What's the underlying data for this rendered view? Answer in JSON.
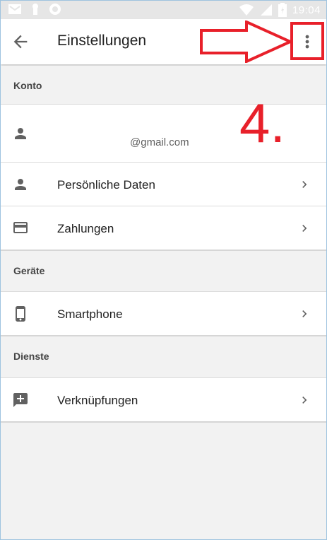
{
  "status_bar": {
    "time": "19:04"
  },
  "app_bar": {
    "title": "Einstellungen"
  },
  "annotation": {
    "step_label": "4."
  },
  "sections": {
    "konto": {
      "header": "Konto",
      "account_email": "@gmail.com",
      "items": [
        {
          "label": "Persönliche Daten"
        },
        {
          "label": "Zahlungen"
        }
      ]
    },
    "geraete": {
      "header": "Geräte",
      "items": [
        {
          "label": "Smartphone"
        }
      ]
    },
    "dienste": {
      "header": "Dienste",
      "items": [
        {
          "label": "Verknüpfungen"
        }
      ]
    }
  },
  "colors": {
    "annotation_red": "#e8202a",
    "icon_gray": "#616161",
    "background": "#f2f2f2"
  }
}
